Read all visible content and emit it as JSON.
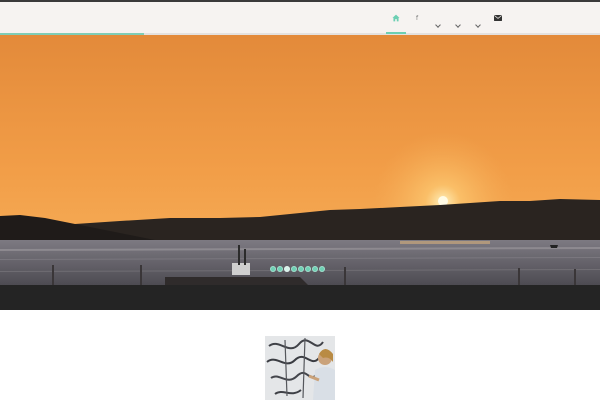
{
  "header": {
    "background": "#f6f3f1",
    "accent": "#6ccfb3",
    "load_progress": 0.24,
    "nav": [
      {
        "name": "home",
        "icon": "home-icon",
        "active": true
      },
      {
        "name": "facebook",
        "icon": "facebook-icon",
        "label": "f"
      },
      {
        "name": "menu-1",
        "icon": "chevron-down-icon"
      },
      {
        "name": "menu-2",
        "icon": "chevron-down-icon"
      },
      {
        "name": "menu-3",
        "icon": "chevron-down-icon"
      },
      {
        "name": "contact",
        "icon": "mail-icon"
      }
    ]
  },
  "hero": {
    "scene": "sunset over bay",
    "slide_count": 8,
    "active_slide": 3,
    "colors": {
      "sky_top": "#e38a3a",
      "sky_bottom": "#f5ad55",
      "sun": "#fff3c0",
      "dot": "#6fd0b4"
    }
  },
  "band": {
    "color": "#242424"
  }
}
